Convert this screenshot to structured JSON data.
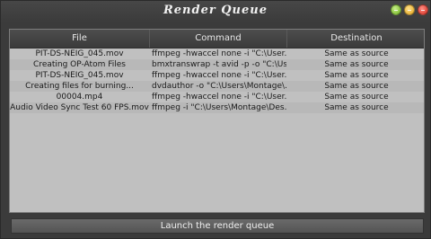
{
  "window": {
    "title": "Render Queue"
  },
  "table": {
    "columns": [
      "File",
      "Command",
      "Destination"
    ],
    "rows": [
      {
        "file": "PIT-DS-NEIG_045.mov",
        "command": "ffmpeg -hwaccel none -i \"C:\\User...",
        "destination": "Same as source"
      },
      {
        "file": "Creating OP-Atom Files",
        "command": "bmxtranswrap -t avid -p -o \"C:\\Us...",
        "destination": "Same as source"
      },
      {
        "file": "PIT-DS-NEIG_045.mov",
        "command": "ffmpeg -hwaccel none -i \"C:\\User...",
        "destination": "Same as source"
      },
      {
        "file": "Creating files for burning...",
        "command": "dvdauthor -o \"C:\\Users\\Montage\\...",
        "destination": "Same as source"
      },
      {
        "file": "00004.mp4",
        "command": "ffmpeg -hwaccel none -i \"C:\\User...",
        "destination": "Same as source"
      },
      {
        "file": "Audio Video Sync Test 60 FPS.mov",
        "command": "ffmpeg -i \"C:\\Users\\Montage\\Des...",
        "destination": "Same as source"
      }
    ]
  },
  "footer": {
    "launch_label": "Launch the render queue"
  }
}
